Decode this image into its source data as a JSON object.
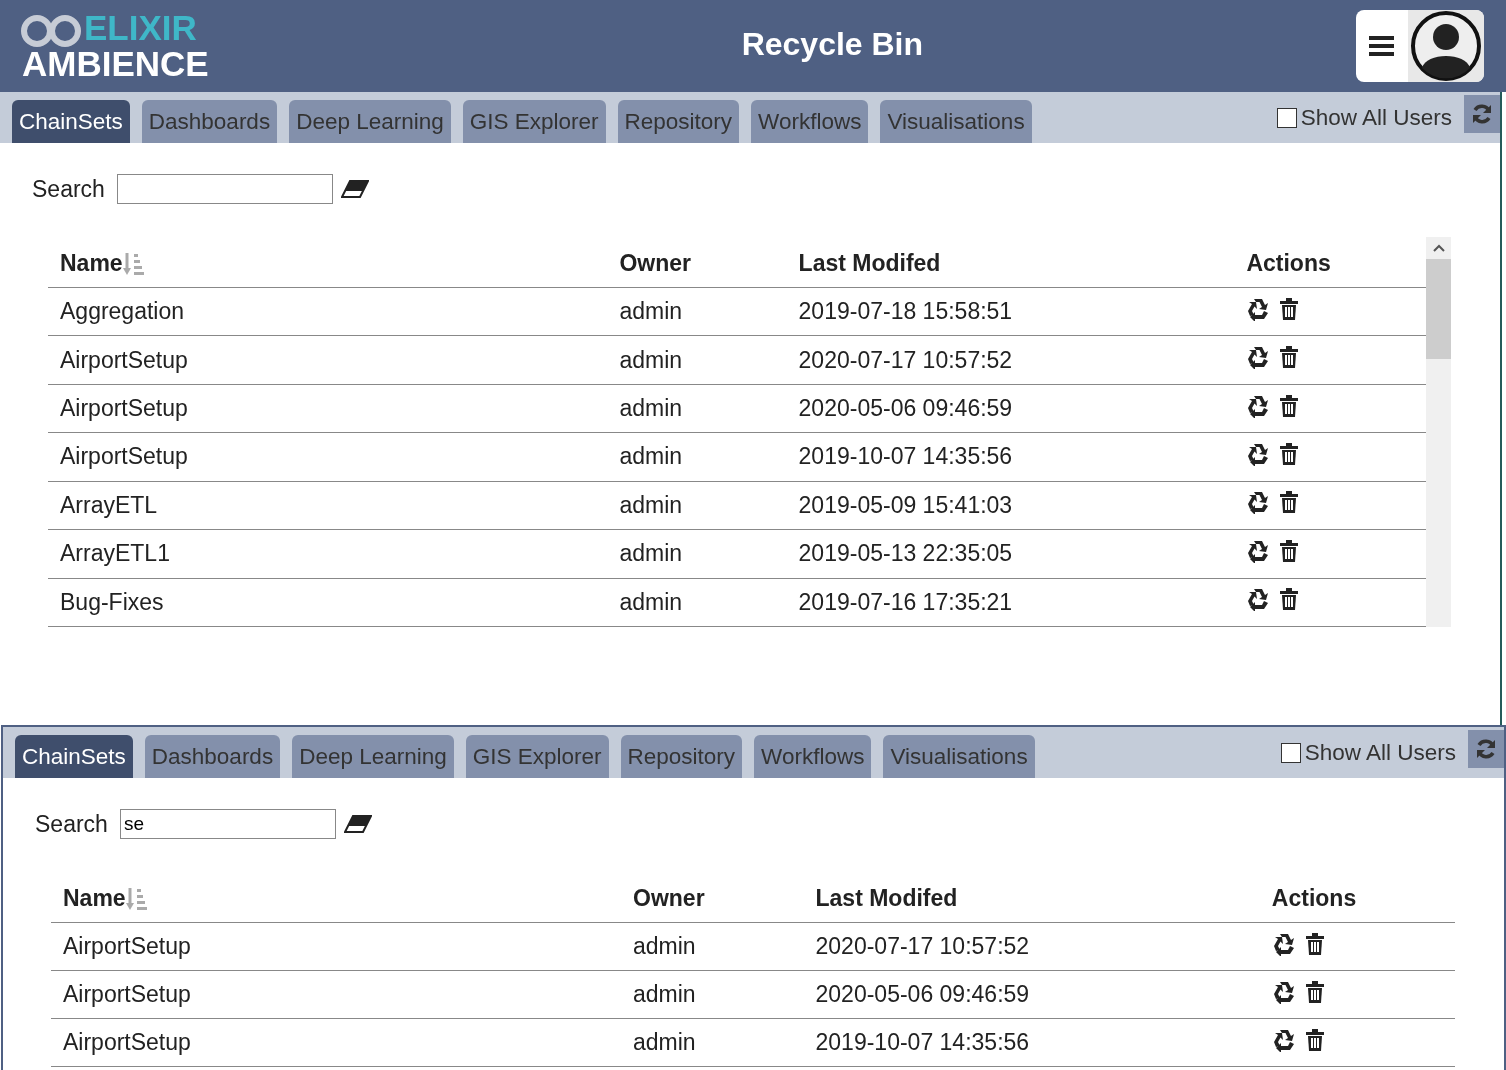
{
  "header": {
    "logo_top": "ELIXIR",
    "logo_bottom": "AMBIENCE",
    "title": "Recycle Bin"
  },
  "panels": [
    {
      "scrollable": true,
      "tabs": [
        {
          "label": "ChainSets",
          "selected": true
        },
        {
          "label": "Dashboards",
          "selected": false
        },
        {
          "label": "Deep Learning",
          "selected": false
        },
        {
          "label": "GIS Explorer",
          "selected": false
        },
        {
          "label": "Repository",
          "selected": false
        },
        {
          "label": "Workflows",
          "selected": false
        },
        {
          "label": "Visualisations",
          "selected": false
        }
      ],
      "show_all_users": {
        "label": "Show All Users",
        "checked": false
      },
      "search": {
        "label": "Search"
      },
      "columns": [
        "Name",
        "Owner",
        "Last Modifed",
        "Actions"
      ],
      "rows": [
        {
          "name": "Aggregation",
          "owner": "admin",
          "modified": "2019-07-18 15:58:51"
        },
        {
          "name": "AirportSetup",
          "owner": "admin",
          "modified": "2020-07-17 10:57:52"
        },
        {
          "name": "AirportSetup",
          "owner": "admin",
          "modified": "2020-05-06 09:46:59"
        },
        {
          "name": "AirportSetup",
          "owner": "admin",
          "modified": "2019-10-07 14:35:56"
        },
        {
          "name": "ArrayETL",
          "owner": "admin",
          "modified": "2019-05-09 15:41:03"
        },
        {
          "name": "ArrayETL1",
          "owner": "admin",
          "modified": "2019-05-13 22:35:05"
        },
        {
          "name": "Bug-Fixes",
          "owner": "admin",
          "modified": "2019-07-16 17:35:21"
        }
      ]
    },
    {
      "scrollable": false,
      "tabs": [
        {
          "label": "ChainSets",
          "selected": true
        },
        {
          "label": "Dashboards",
          "selected": false
        },
        {
          "label": "Deep Learning",
          "selected": false
        },
        {
          "label": "GIS Explorer",
          "selected": false
        },
        {
          "label": "Repository",
          "selected": false
        },
        {
          "label": "Workflows",
          "selected": false
        },
        {
          "label": "Visualisations",
          "selected": false
        }
      ],
      "show_all_users": {
        "label": "Show All Users",
        "checked": false
      },
      "search": {
        "label": "Search",
        "value": "se"
      },
      "columns": [
        "Name",
        "Owner",
        "Last Modifed",
        "Actions"
      ],
      "rows": [
        {
          "name": "AirportSetup",
          "owner": "admin",
          "modified": "2020-07-17 10:57:52"
        },
        {
          "name": "AirportSetup",
          "owner": "admin",
          "modified": "2020-05-06 09:46:59"
        },
        {
          "name": "AirportSetup",
          "owner": "admin",
          "modified": "2019-10-07 14:35:56"
        }
      ]
    }
  ]
}
